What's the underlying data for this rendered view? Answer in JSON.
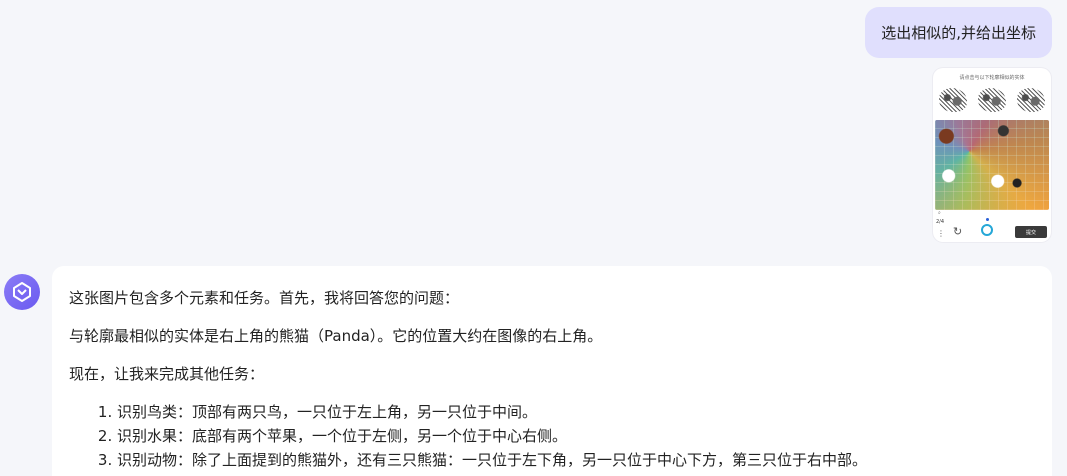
{
  "user_message": {
    "text": "选出相似的,并给出坐标"
  },
  "attachment": {
    "title": "请点击与以下轮廓相似的实体",
    "search_icon": "search-icon",
    "count_label": "2/4",
    "submit_label": "提交"
  },
  "assistant": {
    "avatar_icon": "assistant-logo-icon",
    "paragraphs": [
      "这张图片包含多个元素和任务。首先，我将回答您的问题：",
      "与轮廓最相似的实体是右上角的熊猫（Panda）。它的位置大约在图像的右上角。",
      "现在，让我来完成其他任务："
    ],
    "list": [
      "识别鸟类：顶部有两只鸟，一只位于左上角，另一只位于中间。",
      "识别水果：底部有两个苹果，一个位于左侧，另一个位于中心右侧。",
      "识别动物：除了上面提到的熊猫外，还有三只熊猫：一只位于左下角，另一只位于中心下方，第三只位于右中部。"
    ]
  },
  "colors": {
    "page_bg": "#f5f6fa",
    "user_bubble_bg": "#e0dffd",
    "card_bg": "#ffffff",
    "avatar_accent": "#7b6cf3"
  }
}
